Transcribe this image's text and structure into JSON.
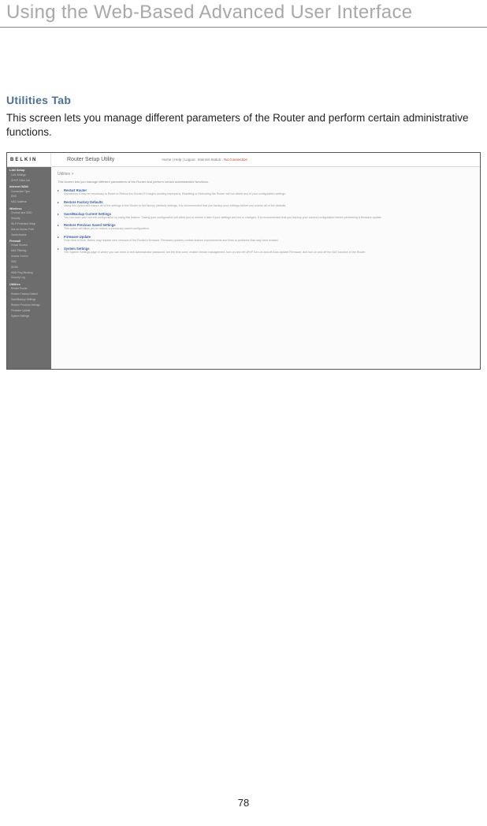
{
  "page": {
    "header": "Using the Web-Based Advanced User Interface",
    "section_title": "Utilities Tab",
    "intro": "This screen lets you manage different parameters of the Router and perform certain administrative functions.",
    "number": "78"
  },
  "screenshot": {
    "logo": "BELKIN",
    "title": "Router Setup Utility",
    "top_links": "Home | Help | Logout",
    "status_label": "Internet Status:",
    "status_value": "No Connection",
    "breadcrumb": "Utilities >",
    "lead": "This screen lets you manage different parameters of the Router and perform certain administrative functions.",
    "sidebar": {
      "sec1": "LAN Setup",
      "items1": [
        "LAN Settings",
        "DHCP Client List"
      ],
      "sec2": "Internet WAN",
      "items2": [
        "Connection Type",
        "DNS",
        "MAC Address"
      ],
      "sec3": "Wireless",
      "items3": [
        "Channel and SSID",
        "Security",
        "Wi-Fi Protected Setup",
        "Use as Access Point",
        "Guest Access"
      ],
      "sec4": "Firewall",
      "items4": [
        "Virtual Servers",
        "MAC Filtering",
        "Access Control",
        "DMZ",
        "DDNS",
        "WAN Ping Blocking",
        "Security Log"
      ],
      "sec5": "Utilities",
      "items5": [
        "Restart Router",
        "Restore Factory Default",
        "Save/Backup Settings",
        "Restore Previous Settings",
        "Firmware Update",
        "System Settings"
      ]
    },
    "utils": [
      {
        "title": "Restart Router",
        "desc": "Sometimes it may be necessary to Reset or Reboot the Router if it begins working improperly. Resetting or Rebooting the Router will not delete any of your configuration settings."
      },
      {
        "title": "Restore Factory Defaults",
        "desc": "Using this option will restore all of the settings in the Router to the factory (default) settings. It is recommended that you backup your settings before you restore all of the defaults."
      },
      {
        "title": "Save/Backup Current Settings",
        "desc": "You can save your current configuration by using this feature. Saving your configuration will allow you to restore it later if your settings are lost or changed. It is recommended that you backup your current configuration before performing a firmware update."
      },
      {
        "title": "Restore Previous Saved Settings",
        "desc": "This option will allow you to restore a previously saved configuration."
      },
      {
        "title": "Firmware Update",
        "desc": "From time to time, Belkin may release new versions of the Router's firmware. Firmware updates contain feature improvements and fixes to problems that may have existed."
      },
      {
        "title": "System Settings",
        "desc": "The System Settings page is where you can enter a new administrator password, set the time zone, enable remote management, turn on and off UPnP, turn on and off Auto Update Firmware, and turn on and off the NAT function of the Router."
      }
    ]
  }
}
